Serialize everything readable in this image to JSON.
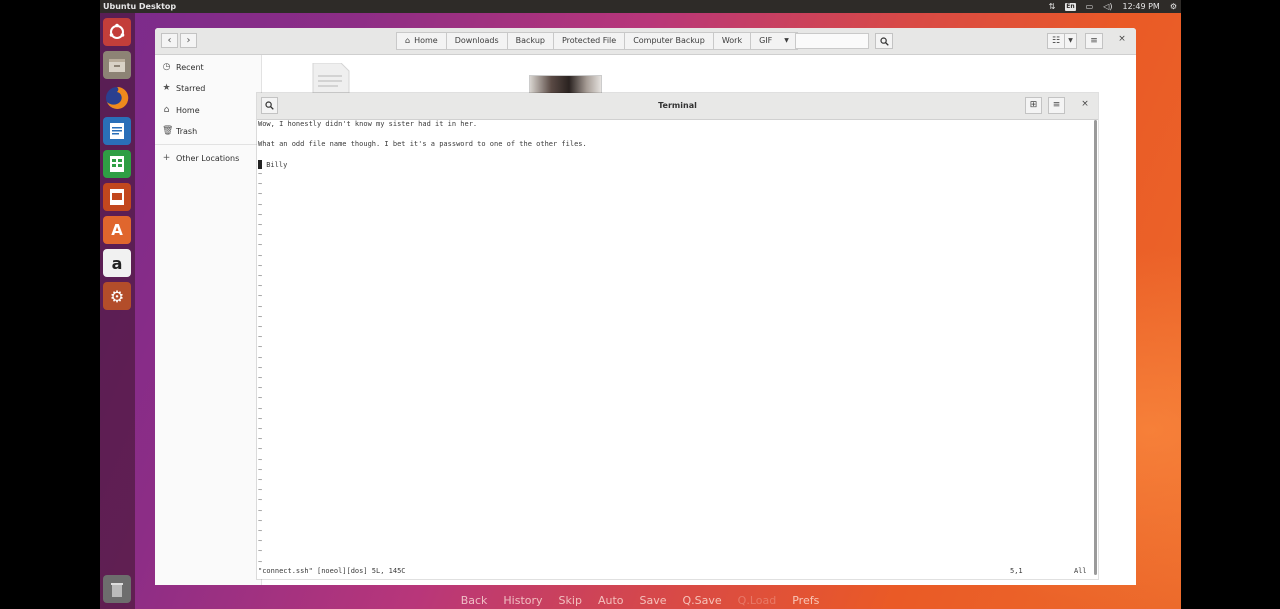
{
  "top_panel": {
    "title": "Ubuntu Desktop",
    "keyboard_layout": "En",
    "clock": "12:49 PM"
  },
  "launcher": {
    "items": [
      {
        "name": "ubuntu-dash",
        "color": "#c0392b"
      },
      {
        "name": "files",
        "color": "#8c8173"
      },
      {
        "name": "firefox",
        "color": "#e66000"
      },
      {
        "name": "libreoffice-writer",
        "color": "#2a6fb8"
      },
      {
        "name": "libreoffice-calc",
        "color": "#2f9e44"
      },
      {
        "name": "libreoffice-impress",
        "color": "#c2471e"
      },
      {
        "name": "software-center",
        "color": "#e0662d"
      },
      {
        "name": "amazon",
        "color": "#2b2b2b"
      },
      {
        "name": "system-settings",
        "color": "#b34d2a"
      },
      {
        "name": "trash",
        "color": "#6d6d6d"
      }
    ]
  },
  "nautilus": {
    "path": [
      "Home",
      "Downloads",
      "Backup",
      "Protected File",
      "Computer Backup",
      "Work",
      "GIF"
    ],
    "sidebar": [
      "Recent",
      "Starred",
      "Home",
      "Trash",
      "Other Locations"
    ]
  },
  "terminal": {
    "title": "Terminal",
    "lines": [
      "Wow, I honestly didn't know my sister had it in her.",
      "",
      "What an odd file name though. I bet it's a password to one of the other files.",
      "",
      " Billy"
    ],
    "status_file": "\"connect.ssh\" [noeol][dos] 5L, 145C",
    "status_pos": "5,1",
    "status_scroll": "All"
  },
  "quick_menu": [
    "Back",
    "History",
    "Skip",
    "Auto",
    "Save",
    "Q.Save",
    "Q.Load",
    "Prefs"
  ],
  "colors": {
    "panel": "#2e2b28",
    "accent_orange": "#e95420",
    "wallpaper_purple": "#8d2d86"
  }
}
